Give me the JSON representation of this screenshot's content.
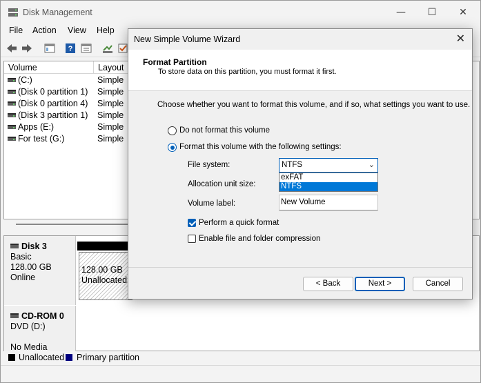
{
  "app": {
    "title": "Disk Management",
    "window_controls": {
      "minimize": "—",
      "maximize": "☐",
      "close": "✕"
    }
  },
  "menu": [
    "File",
    "Action",
    "View",
    "Help"
  ],
  "volume_list": {
    "columns": [
      "Volume",
      "Layout"
    ],
    "rows": [
      {
        "name": " (C:)",
        "layout": "Simple"
      },
      {
        "name": "(Disk 0 partition 1)",
        "layout": "Simple"
      },
      {
        "name": "(Disk 0 partition 4)",
        "layout": "Simple"
      },
      {
        "name": "(Disk 3 partition 1)",
        "layout": "Simple"
      },
      {
        "name": "Apps (E:)",
        "layout": "Simple"
      },
      {
        "name": "For test (G:)",
        "layout": "Simple"
      }
    ]
  },
  "disks": [
    {
      "name": "Disk 3",
      "type": "Basic",
      "size": "128.00 GB",
      "status": "Online",
      "partition": {
        "size": "128.00 GB",
        "label": "Unallocated"
      }
    },
    {
      "name": "CD-ROM 0",
      "type": "DVD (D:)",
      "status": "No Media"
    }
  ],
  "legend": [
    {
      "label": "Unallocated",
      "color": "#000000"
    },
    {
      "label": "Primary partition",
      "color": "#000080"
    }
  ],
  "wizard": {
    "title": "New Simple Volume Wizard",
    "close": "✕",
    "header_title": "Format Partition",
    "header_subtitle": "To store data on this partition, you must format it first.",
    "description": "Choose whether you want to format this volume, and if so, what settings you want to use.",
    "option_no_format": "Do not format this volume",
    "option_format": "Format this volume with the following settings:",
    "file_system_label": "File system:",
    "file_system_value": "NTFS",
    "file_system_options": [
      "exFAT",
      "NTFS"
    ],
    "allocation_label": "Allocation unit size:",
    "volume_label_label": "Volume label:",
    "volume_label_value": "New Volume",
    "quick_format_label": "Perform a quick format",
    "quick_format_checked": true,
    "compression_label": "Enable file and folder compression",
    "compression_checked": false,
    "back_label": "< Back",
    "next_label": "Next >",
    "cancel_label": "Cancel"
  }
}
